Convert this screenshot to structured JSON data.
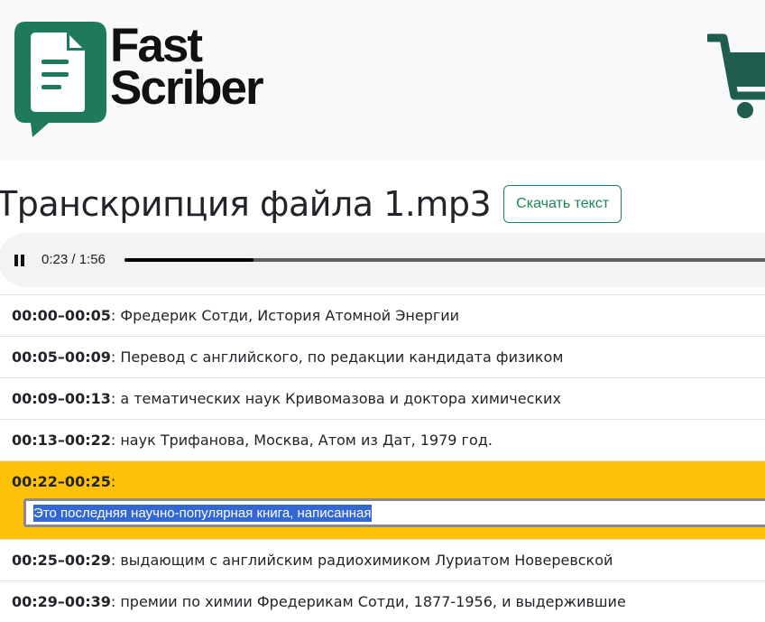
{
  "brand": {
    "line1": "Fast",
    "line2": "Scriber",
    "logo_icon": "document-chat-icon",
    "cart_icon": "shopping-cart-icon",
    "color": "#1f7a5c"
  },
  "title": "Транскрипция файла 1.mp3",
  "download_label": "Скачать текст",
  "player": {
    "state": "playing",
    "time": "0:23 / 1:56",
    "progress": 0.198
  },
  "segments": [
    {
      "time": "00:00–00:05",
      "text": ": Фредерик Сотди, История Атомной Энергии"
    },
    {
      "time": "00:05–00:09",
      "text": ": Перевод с английского, по редакции кандидата физиком"
    },
    {
      "time": "00:09–00:13",
      "text": ": а тематических наук Кривомазова и доктора химических"
    },
    {
      "time": "00:13–00:22",
      "text": ": наук Трифанова, Москва, Атом из Дат, 1979 год."
    }
  ],
  "active_segment": {
    "time": "00:22–00:25",
    "suffix": ":",
    "edit_value": "Это последняя научно-популярная книга, написанная"
  },
  "segments_after": [
    {
      "time": "00:25–00:29",
      "text": ": выдающим с английским радиохимиком Луриатом Новеревской"
    },
    {
      "time": "00:29–00:39",
      "text": ": премии по химии Фредерикам Сотди, 1877-1956, и выдержившие"
    }
  ],
  "colors": {
    "active_bg": "#ffc107",
    "accent": "#198754",
    "selection": "#3367d6"
  }
}
